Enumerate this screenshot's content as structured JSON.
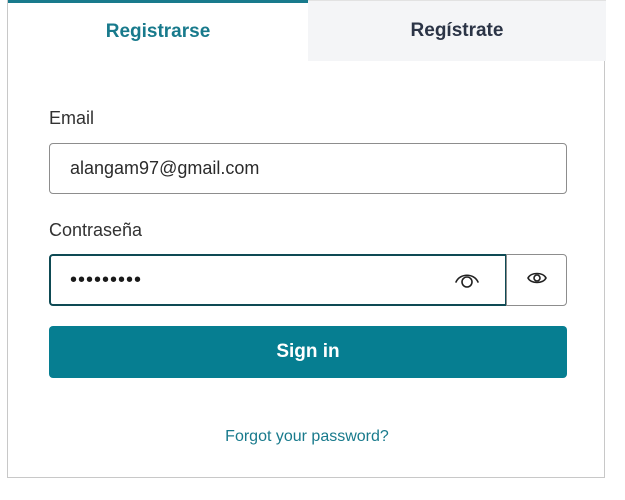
{
  "tabs": [
    {
      "label": "Registrarse",
      "active": true
    },
    {
      "label": "Regístrate",
      "active": false
    }
  ],
  "form": {
    "email_label": "Email",
    "email_value": "alangam97@gmail.com",
    "password_label": "Contraseña",
    "password_value": "•••••••••",
    "signin_label": "Sign in",
    "forgot_label": "Forgot your password?"
  },
  "icons": {
    "inner_toggle": "eye-outline-icon",
    "side_toggle": "eye-icon"
  },
  "colors": {
    "accent": "#067e91",
    "accent_text": "#187a8c",
    "focus_border": "#0e4a54",
    "tab_inactive_bg": "#f4f5f7"
  }
}
